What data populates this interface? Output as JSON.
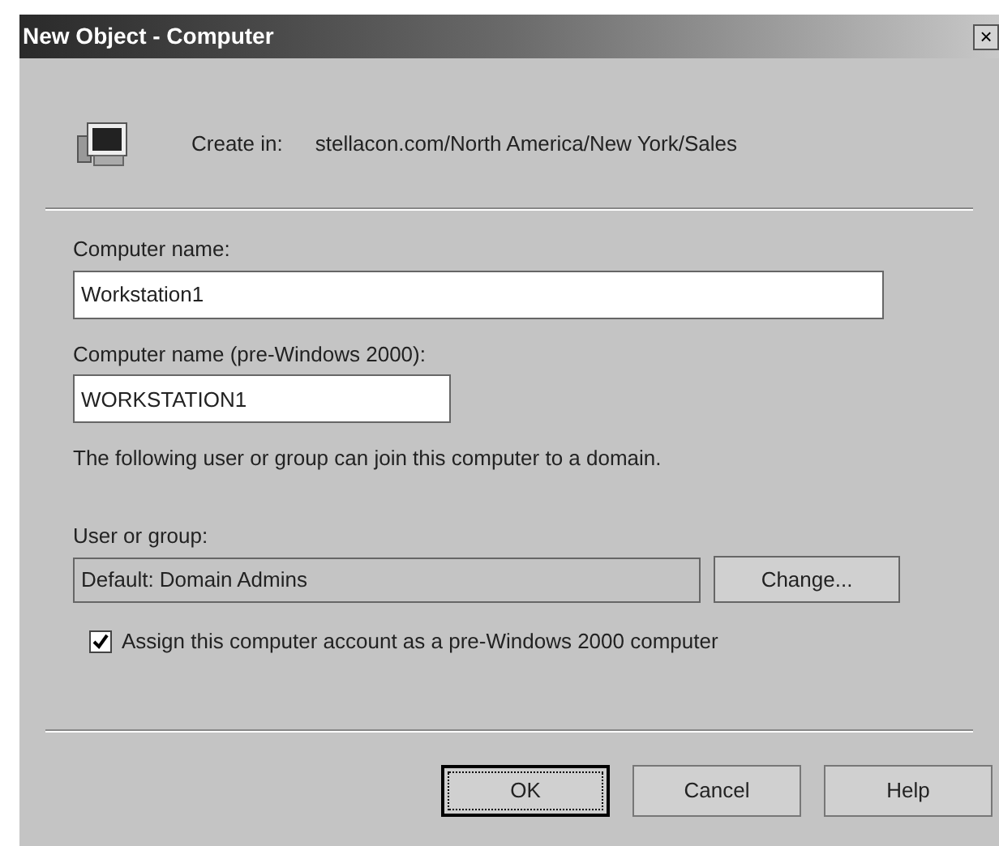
{
  "window": {
    "title": "New Object - Computer",
    "close": "×"
  },
  "create_in": {
    "label": "Create in:",
    "path": "stellacon.com/North America/New York/Sales"
  },
  "fields": [
    {
      "label": "Computer name:",
      "value": "Workstation1",
      "kind": "wide"
    },
    {
      "label": "Computer name (pre-Windows 2000):",
      "value": "WORKSTATION1",
      "kind": "narrow"
    }
  ],
  "note": "The following user or group can join this computer to a domain.",
  "user_or_group": {
    "label": "User or group:",
    "value": "Default: Domain Admins",
    "disabled": true,
    "button": "Change..."
  },
  "checkbox": {
    "label": "Assign this computer account as a pre-Windows 2000 computer",
    "checked": true
  },
  "buttons": [
    {
      "label": "OK",
      "focused": true
    },
    {
      "label": "Cancel",
      "focused": false
    },
    {
      "label": "Help",
      "focused": false
    }
  ]
}
